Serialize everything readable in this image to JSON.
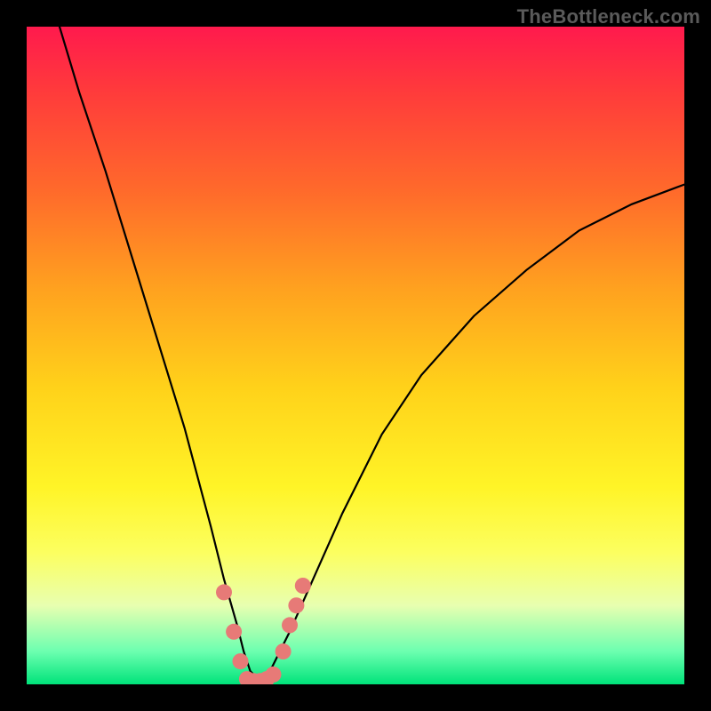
{
  "watermark": "TheBottleneck.com",
  "chart_data": {
    "type": "line",
    "title": "",
    "xlabel": "",
    "ylabel": "",
    "xlim": [
      0,
      100
    ],
    "ylim": [
      0,
      100
    ],
    "grid": false,
    "legend": false,
    "series": [
      {
        "name": "bottleneck-curve",
        "color": "#000000",
        "x": [
          5,
          8,
          12,
          16,
          20,
          24,
          28,
          30,
          32,
          33,
          34,
          35,
          36,
          37,
          38,
          40,
          44,
          48,
          54,
          60,
          68,
          76,
          84,
          92,
          100
        ],
        "y": [
          100,
          90,
          78,
          65,
          52,
          39,
          24,
          16,
          9,
          5,
          2,
          1,
          1,
          2,
          4,
          8,
          17,
          26,
          38,
          47,
          56,
          63,
          69,
          73,
          76
        ]
      }
    ],
    "markers": [
      {
        "name": "threshold-dots",
        "color": "#e77a77",
        "radius": 9,
        "points": [
          {
            "x": 30.0,
            "y": 14.0
          },
          {
            "x": 31.5,
            "y": 8.0
          },
          {
            "x": 32.5,
            "y": 3.5
          },
          {
            "x": 33.5,
            "y": 0.8
          },
          {
            "x": 34.5,
            "y": 0.5
          },
          {
            "x": 35.5,
            "y": 0.5
          },
          {
            "x": 36.5,
            "y": 0.8
          },
          {
            "x": 37.5,
            "y": 1.5
          },
          {
            "x": 39.0,
            "y": 5.0
          },
          {
            "x": 40.0,
            "y": 9.0
          },
          {
            "x": 41.0,
            "y": 12.0
          },
          {
            "x": 42.0,
            "y": 15.0
          }
        ]
      }
    ],
    "gradient_stops": [
      {
        "pos": 0.0,
        "color": "#ff1a4d"
      },
      {
        "pos": 0.1,
        "color": "#ff3b3b"
      },
      {
        "pos": 0.25,
        "color": "#ff6a2b"
      },
      {
        "pos": 0.4,
        "color": "#ffa21f"
      },
      {
        "pos": 0.55,
        "color": "#ffd21a"
      },
      {
        "pos": 0.7,
        "color": "#fff427"
      },
      {
        "pos": 0.8,
        "color": "#fcff60"
      },
      {
        "pos": 0.88,
        "color": "#e8ffb0"
      },
      {
        "pos": 0.95,
        "color": "#6cffb0"
      },
      {
        "pos": 1.0,
        "color": "#00e37a"
      }
    ]
  }
}
